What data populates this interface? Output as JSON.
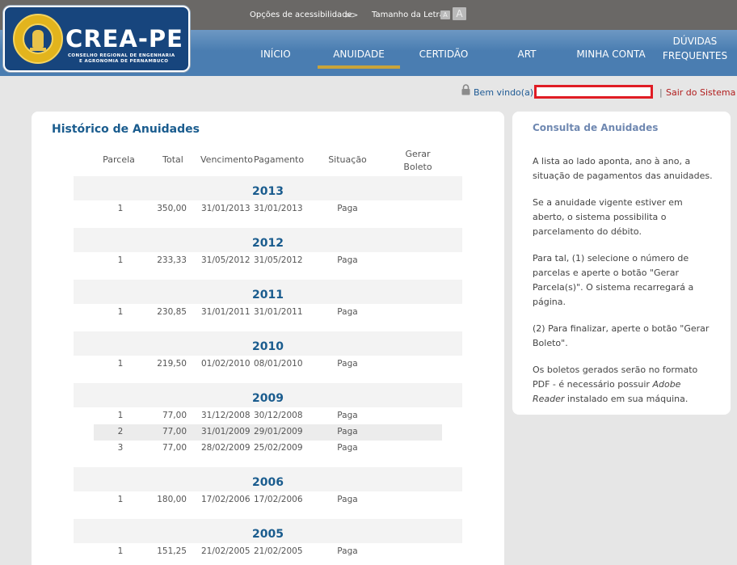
{
  "topbar": {
    "accessibility_label": "Opções de acessibilidade",
    "accessibility_arrow": ">>",
    "font_size_label": "Tamanho da Letra",
    "font_small": "A",
    "font_big": "A"
  },
  "logo": {
    "title": "CREA-PE",
    "subtitle_line1": "CONSELHO REGIONAL DE ENGENHARIA",
    "subtitle_line2": "E AGRONOMIA DE PERNAMBUCO"
  },
  "nav": {
    "items": [
      {
        "label": "INÍCIO"
      },
      {
        "label": "ANUIDADE"
      },
      {
        "label": "CERTIDÃO"
      },
      {
        "label": "ART"
      },
      {
        "label": "MINHA CONTA"
      },
      {
        "label": "DÚVIDAS\nFREQUENTES"
      }
    ],
    "active": "ANUIDADE"
  },
  "user": {
    "welcome": "Bem vindo(a),",
    "separator": "|",
    "logout": "Sair do Sistema"
  },
  "history": {
    "title": "Histórico de Anuidades",
    "headers": [
      "Parcela",
      "Total",
      "Vencimento",
      "Pagamento",
      "Situação",
      "Gerar\nBoleto"
    ],
    "years": [
      {
        "year": "2013",
        "rows": [
          [
            "1",
            "350,00",
            "31/01/2013",
            "31/01/2013",
            "Paga"
          ]
        ]
      },
      {
        "year": "2012",
        "rows": [
          [
            "1",
            "233,33",
            "31/05/2012",
            "31/05/2012",
            "Paga"
          ]
        ]
      },
      {
        "year": "2011",
        "rows": [
          [
            "1",
            "230,85",
            "31/01/2011",
            "31/01/2011",
            "Paga"
          ]
        ]
      },
      {
        "year": "2010",
        "rows": [
          [
            "1",
            "219,50",
            "01/02/2010",
            "08/01/2010",
            "Paga"
          ]
        ]
      },
      {
        "year": "2009",
        "rows": [
          [
            "1",
            "77,00",
            "31/12/2008",
            "30/12/2008",
            "Paga"
          ],
          [
            "2",
            "77,00",
            "31/01/2009",
            "29/01/2009",
            "Paga"
          ],
          [
            "3",
            "77,00",
            "28/02/2009",
            "25/02/2009",
            "Paga"
          ]
        ]
      },
      {
        "year": "2006",
        "rows": [
          [
            "1",
            "180,00",
            "17/02/2006",
            "17/02/2006",
            "Paga"
          ]
        ]
      },
      {
        "year": "2005",
        "rows": [
          [
            "1",
            "151,25",
            "21/02/2005",
            "21/02/2005",
            "Paga"
          ]
        ]
      }
    ]
  },
  "side": {
    "title": "Consulta de Anuidades",
    "p1": "A lista ao lado aponta, ano à ano, a situação de pagamentos das anuidades.",
    "p2": "Se a anuidade vigente estiver em aberto, o sistema possibilita o parcelamento do débito.",
    "p3": "Para tal, (1) selecione o número de parcelas e aperte o botão \"Gerar Parcela(s)\". O sistema recarregará a página.",
    "p4": "(2) Para finalizar, aperte o botão \"Gerar Boleto\".",
    "p5_before": "Os boletos gerados serão no formato PDF - é necessário possuir ",
    "p5_italic": "Adobe Reader",
    "p5_after": " instalado em sua máquina."
  },
  "colors": {
    "nav_blue": "#4a7db1",
    "active_underline": "#c9a43a",
    "title_blue": "#1a5c8e",
    "logout_red": "#b11c1c",
    "logo_navy": "#17457d"
  }
}
